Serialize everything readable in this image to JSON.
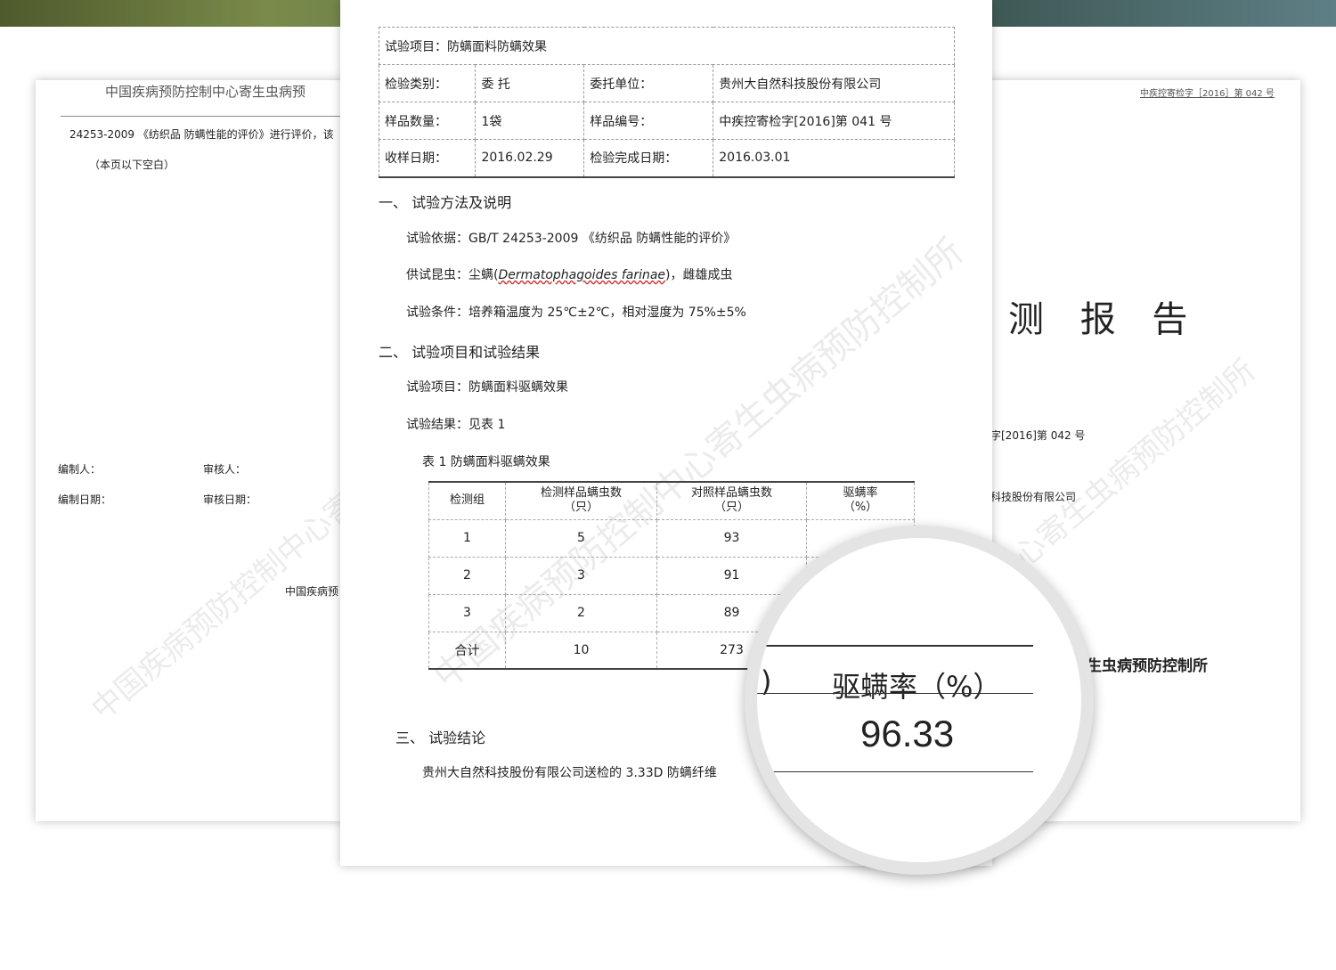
{
  "left": {
    "header": "中国疾病预防控制中心寄生虫病预",
    "line1": "24253-2009 《纺织品 防螨性能的评价》进行评价，该",
    "line2": "（本页以下空白）",
    "prep": "编制人：",
    "review": "审核人：",
    "prep_date": "编制日期：",
    "review_date": "审核日期：",
    "footer": "中国疾病预",
    "wm": "中国疾病预防控制中心寄生"
  },
  "right": {
    "header": "中疾控寄检字［2016］第 042 号",
    "title": "测 报 告",
    "ref": "字[2016]第 042 号",
    "company": "科技股份有限公司",
    "footer": "生虫病预防控制所",
    "wm": "中心寄生虫病预防控制所"
  },
  "center": {
    "wm": "中国疾病预防控制中心寄生虫病预防控制所",
    "item": "试验项目：防螨面料防螨效果",
    "hdr": [
      [
        "检验类别：",
        "委 托",
        "委托单位：",
        "贵州大自然科技股份有限公司"
      ],
      [
        "样品数量：",
        "1袋",
        "样品编号：",
        "中疾控寄检字[2016]第 041 号"
      ],
      [
        "收样日期：",
        "2016.02.29",
        "检验完成日期：",
        "2016.03.01"
      ]
    ],
    "s1": "一、 试验方法及说明",
    "basis": "试验依据：GB/T 24253-2009 《纺织品 防螨性能的评价》",
    "insect_pre": "供试昆虫：尘螨(",
    "insect_latin": "Dermatophagoides farinae",
    "insect_post": ")，雌雄成虫",
    "cond": "试验条件：培养箱温度为 25℃±2℃，相对湿度为 75%±5%",
    "s2": "二、 试验项目和试验结果",
    "test_item": "试验项目：防螨面料驱螨效果",
    "test_result": "试验结果：见表 1",
    "table_title": "表 1  防螨面料驱螨效果",
    "cols": [
      "检测组",
      "检测样品螨虫数\n（只）",
      "对照样品螨虫数\n（只）",
      "驱螨率\n（%）"
    ],
    "rows": [
      [
        "1",
        "5",
        "93",
        ""
      ],
      [
        "2",
        "3",
        "91",
        ""
      ],
      [
        "3",
        "2",
        "89",
        ""
      ],
      [
        "合计",
        "10",
        "273",
        ""
      ]
    ],
    "s3": "三、 试验结论",
    "concl": "贵州大自然科技股份有限公司送检的 3.33D 防螨纤维"
  },
  "mag": {
    "paren": ")",
    "label": "驱螨率（%）",
    "value": "96.33"
  }
}
